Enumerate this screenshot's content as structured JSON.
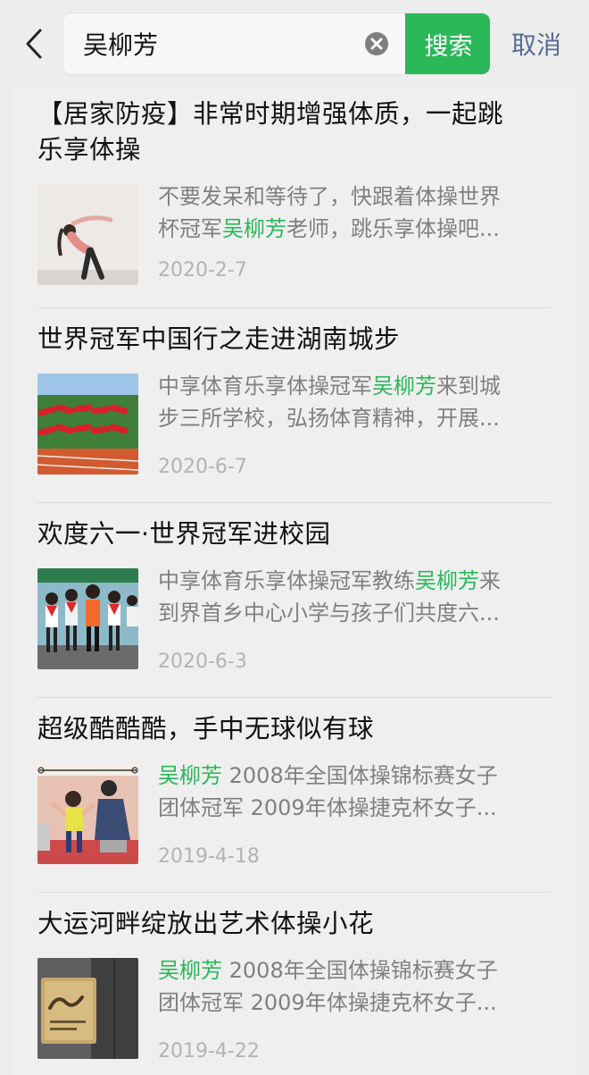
{
  "search": {
    "query": "吴柳芳",
    "button_label": "搜索",
    "cancel_label": "取消"
  },
  "icons": {
    "back": "back-chevron-icon",
    "clear": "clear-circle-icon"
  },
  "colors": {
    "accent_green": "#2ab859",
    "link_blue": "#576b95",
    "snippet_gray": "#808080",
    "date_gray": "#b3b3b3"
  },
  "results": [
    {
      "title_line1": "【居家防疫】非常时期增强体质，一起跳",
      "title_line2": "乐享体操",
      "snippet_line1_before": "不要发呆和等待了，快跟着体操世界",
      "snippet_line1_hl": "",
      "snippet_line1_after": "",
      "snippet_line2_before": "杯冠军",
      "snippet_line2_hl": "吴柳芳",
      "snippet_line2_after": "老师，跳乐享体操吧...",
      "date": "2020-2-7"
    },
    {
      "title_line1": "世界冠军中国行之走进湖南城步",
      "title_line2": "",
      "snippet_line1_before": "中享体育乐享体操冠军",
      "snippet_line1_hl": "吴柳芳",
      "snippet_line1_after": "来到城",
      "snippet_line2_before": "步三所学校，弘扬体育精神，开展...",
      "snippet_line2_hl": "",
      "snippet_line2_after": "",
      "date": "2020-6-7"
    },
    {
      "title_line1": "欢度六一·世界冠军进校园",
      "title_line2": "",
      "snippet_line1_before": "中享体育乐享体操冠军教练",
      "snippet_line1_hl": "吴柳芳",
      "snippet_line1_after": "来",
      "snippet_line2_before": "到界首乡中心小学与孩子们共度六...",
      "snippet_line2_hl": "",
      "snippet_line2_after": "",
      "date": "2020-6-3"
    },
    {
      "title_line1": "超级酷酷酷，手中无球似有球",
      "title_line2": "",
      "snippet_line1_before": "",
      "snippet_line1_hl": "吴柳芳",
      "snippet_line1_after": " 2008年全国体操锦标赛女子",
      "snippet_line2_before": "团体冠军 2009年体操捷克杯女子...",
      "snippet_line2_hl": "",
      "snippet_line2_after": "",
      "date": "2019-4-18"
    },
    {
      "title_line1": "大运河畔绽放出艺术体操小花",
      "title_line2": "",
      "snippet_line1_before": "",
      "snippet_line1_hl": "吴柳芳",
      "snippet_line1_after": " 2008年全国体操锦标赛女子",
      "snippet_line2_before": "团体冠军 2009年体操捷克杯女子...",
      "snippet_line2_hl": "",
      "snippet_line2_after": "",
      "date": "2019-4-22"
    }
  ]
}
